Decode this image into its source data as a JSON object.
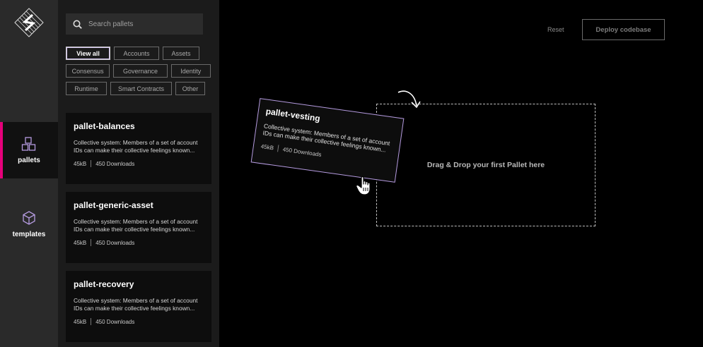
{
  "rail": {
    "items": [
      {
        "label": "pallets",
        "icon": "blocks-icon",
        "active": true
      },
      {
        "label": "templates",
        "icon": "cube-icon",
        "active": false
      }
    ]
  },
  "search": {
    "placeholder": "Search pallets"
  },
  "filters": {
    "rows": [
      [
        "View all",
        "Accounts",
        "Assets"
      ],
      [
        "Consensus",
        "Governance",
        "Identity"
      ],
      [
        "Runtime",
        "Smart Contracts",
        "Other"
      ]
    ],
    "active": "View all"
  },
  "pallets": [
    {
      "name": "pallet-balances",
      "description": "Collective system: Members of a set of account IDs can make their collective feelings known...",
      "size": "45kB",
      "downloads": "450 Downloads"
    },
    {
      "name": "pallet-generic-asset",
      "description": "Collective system: Members of a set of account IDs can make their collective feelings known...",
      "size": "45kB",
      "downloads": "450 Downloads"
    },
    {
      "name": "pallet-recovery",
      "description": "Collective system: Members of a set of account IDs can make their collective feelings known...",
      "size": "45kB",
      "downloads": "450 Downloads"
    }
  ],
  "dragging": {
    "name": "pallet-vesting",
    "description": "Collective system: Members of a set of account IDs can make their collective feelings known...",
    "size": "45kB",
    "downloads": "450 Downloads"
  },
  "toolbar": {
    "reset_label": "Reset",
    "deploy_label": "Deploy codebase"
  },
  "dropzone": {
    "label": "Drag & Drop your first Pallet here"
  },
  "colors": {
    "accent": "#e6007a",
    "drag_border": "#b59be0",
    "rail_bg": "#2a2a2a",
    "panel_bg": "#1b1b1b",
    "card_bg": "#0d0d0d",
    "canvas_bg": "#000000"
  }
}
